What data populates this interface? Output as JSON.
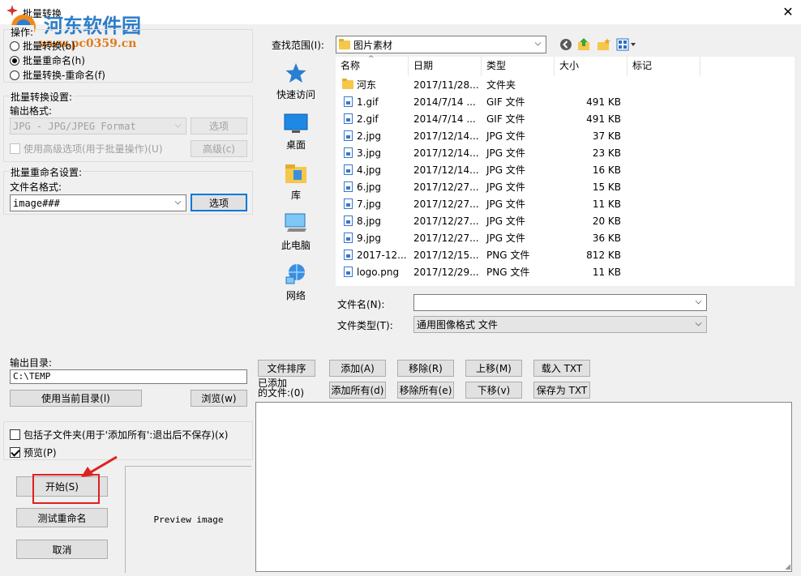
{
  "window": {
    "title": "批量转换",
    "watermark_name": "河东软件园",
    "watermark_url": "www.pc0359.cn"
  },
  "operation": {
    "group_label": "操作:",
    "options": [
      {
        "label": "批量转换(b)",
        "selected": false
      },
      {
        "label": "批量重命名(h)",
        "selected": true
      },
      {
        "label": "批量转换-重命名(f)",
        "selected": false
      }
    ]
  },
  "convert_settings": {
    "group_label": "批量转换设置:",
    "output_format_label": "输出格式:",
    "output_format_value": "JPG - JPG/JPEG Format",
    "options_button": "选项",
    "advanced_checkbox": "使用高级选项(用于批量操作)(U)",
    "advanced_button": "高级(c)"
  },
  "rename_settings": {
    "group_label": "批量重命名设置:",
    "filename_format_label": "文件名格式:",
    "filename_format_value": "image###",
    "options_button": "选项"
  },
  "output_dir": {
    "label": "输出目录:",
    "value": "C:\\TEMP",
    "use_current_button": "使用当前目录(l)",
    "browse_button": "浏览(w)"
  },
  "bottom_options": {
    "include_subfolders": {
      "label": "包括子文件夹(用于'添加所有':退出后不保存)(x)",
      "checked": false
    },
    "preview": {
      "label": "预览(P)",
      "checked": true
    }
  },
  "actions": {
    "start_button": "开始(S)",
    "test_rename_button": "测试重命名",
    "cancel_button": "取消"
  },
  "preview_box": {
    "label": "Preview image"
  },
  "browser": {
    "lookin_label": "查找范围(I):",
    "lookin_value": "图片素材",
    "places": [
      {
        "label": "快速访问",
        "icon": "star-icon"
      },
      {
        "label": "桌面",
        "icon": "desktop-icon"
      },
      {
        "label": "库",
        "icon": "library-icon"
      },
      {
        "label": "此电脑",
        "icon": "computer-icon"
      },
      {
        "label": "网络",
        "icon": "network-icon"
      }
    ],
    "columns": [
      "名称",
      "日期",
      "类型",
      "大小",
      "标记"
    ],
    "files": [
      {
        "name": "河东",
        "date": "2017/11/28...",
        "type": "文件夹",
        "size": "",
        "icon": "folder-icon"
      },
      {
        "name": "1.gif",
        "date": "2014/7/14 ...",
        "type": "GIF 文件",
        "size": "491 KB",
        "icon": "image-file-icon"
      },
      {
        "name": "2.gif",
        "date": "2014/7/14 ...",
        "type": "GIF 文件",
        "size": "491 KB",
        "icon": "image-file-icon"
      },
      {
        "name": "2.jpg",
        "date": "2017/12/14...",
        "type": "JPG 文件",
        "size": "37 KB",
        "icon": "image-file-icon"
      },
      {
        "name": "3.jpg",
        "date": "2017/12/14...",
        "type": "JPG 文件",
        "size": "23 KB",
        "icon": "image-file-icon"
      },
      {
        "name": "4.jpg",
        "date": "2017/12/14...",
        "type": "JPG 文件",
        "size": "16 KB",
        "icon": "image-file-icon"
      },
      {
        "name": "6.jpg",
        "date": "2017/12/27...",
        "type": "JPG 文件",
        "size": "15 KB",
        "icon": "image-file-icon"
      },
      {
        "name": "7.jpg",
        "date": "2017/12/27...",
        "type": "JPG 文件",
        "size": "11 KB",
        "icon": "image-file-icon"
      },
      {
        "name": "8.jpg",
        "date": "2017/12/27...",
        "type": "JPG 文件",
        "size": "20 KB",
        "icon": "image-file-icon"
      },
      {
        "name": "9.jpg",
        "date": "2017/12/27...",
        "type": "JPG 文件",
        "size": "36 KB",
        "icon": "image-file-icon"
      },
      {
        "name": "2017-12...",
        "date": "2017/12/15...",
        "type": "PNG 文件",
        "size": "812 KB",
        "icon": "image-file-icon"
      },
      {
        "name": "logo.png",
        "date": "2017/12/29...",
        "type": "PNG 文件",
        "size": "11 KB",
        "icon": "image-file-icon"
      }
    ],
    "filename_label": "文件名(N):",
    "filename_value": "",
    "filetype_label": "文件类型(T):",
    "filetype_value": "通用图像格式 文件"
  },
  "list_buttons": {
    "sort": "文件排序",
    "add": "添加(A)",
    "remove": "移除(R)",
    "move_up": "上移(M)",
    "load_txt": "载入 TXT",
    "add_all": "添加所有(d)",
    "remove_all": "移除所有(e)",
    "move_down": "下移(v)",
    "save_txt": "保存为 TXT"
  },
  "added_files": {
    "label": "已添加\n的文件:(0)"
  }
}
